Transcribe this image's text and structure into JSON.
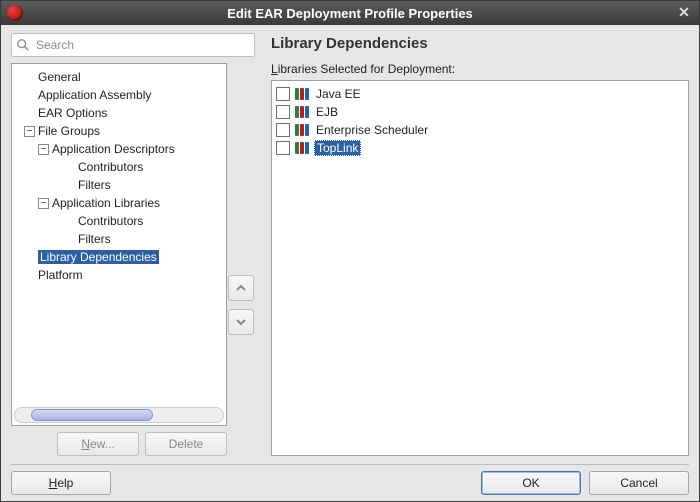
{
  "window": {
    "title": "Edit EAR Deployment Profile Properties"
  },
  "search": {
    "placeholder": "Search"
  },
  "tree": {
    "general": {
      "label": "General"
    },
    "application_assembly": {
      "label": "Application Assembly"
    },
    "ear_options": {
      "label": "EAR Options"
    },
    "file_groups": {
      "label": "File Groups"
    },
    "app_descriptors": {
      "label": "Application Descriptors"
    },
    "ad_contributors": {
      "label": "Contributors"
    },
    "ad_filters": {
      "label": "Filters"
    },
    "app_libraries": {
      "label": "Application Libraries"
    },
    "al_contributors": {
      "label": "Contributors"
    },
    "al_filters": {
      "label": "Filters"
    },
    "library_deps": {
      "label": "Library Dependencies"
    },
    "platform": {
      "label": "Platform"
    }
  },
  "tree_buttons": {
    "new": {
      "mnemonic": "N",
      "rest": "ew..."
    },
    "delete": {
      "label": "Delete"
    }
  },
  "page": {
    "title": "Library Dependencies",
    "list_label_mnemonic": "L",
    "list_label_rest": "ibraries Selected for Deployment:"
  },
  "libraries": [
    {
      "label": "Java EE",
      "checked": false,
      "selected": false
    },
    {
      "label": "EJB",
      "checked": false,
      "selected": false
    },
    {
      "label": "Enterprise Scheduler",
      "checked": false,
      "selected": false
    },
    {
      "label": "TopLink",
      "checked": false,
      "selected": true
    }
  ],
  "footer": {
    "help": {
      "mnemonic": "H",
      "rest": "elp"
    },
    "ok": {
      "label": "OK"
    },
    "cancel": {
      "label": "Cancel"
    }
  }
}
